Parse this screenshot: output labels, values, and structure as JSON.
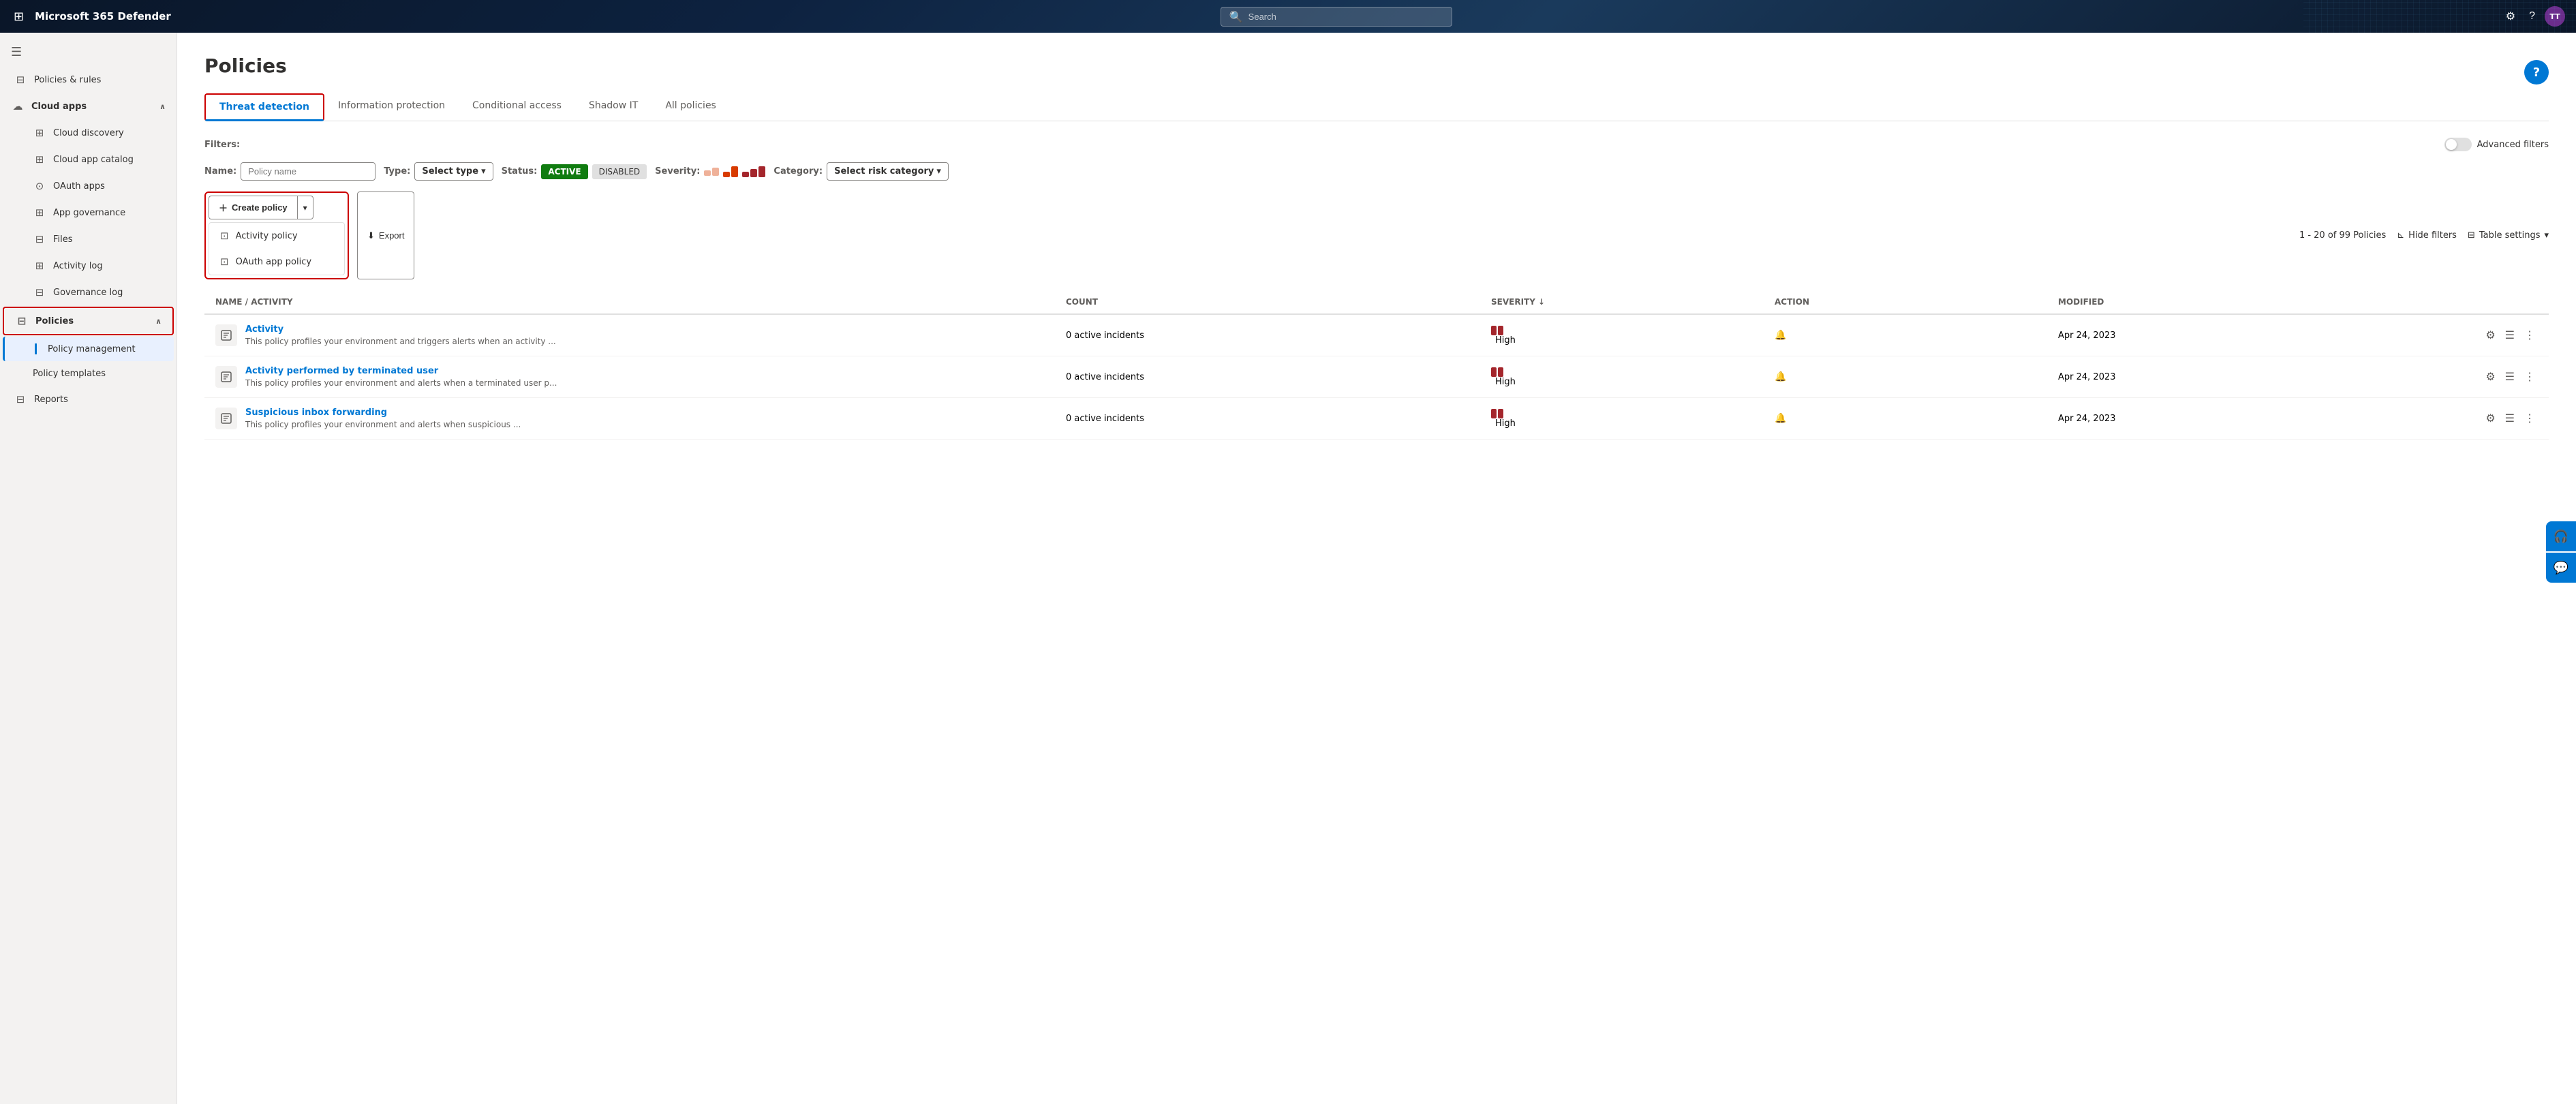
{
  "app": {
    "title": "Microsoft 365 Defender",
    "search_placeholder": "Search"
  },
  "nav_icons": {
    "settings": "⚙",
    "help": "?",
    "avatar": "TT"
  },
  "sidebar": {
    "hamburger": "☰",
    "items": [
      {
        "id": "policies-rules",
        "label": "Policies & rules",
        "icon": "⊟"
      },
      {
        "id": "cloud-apps",
        "label": "Cloud apps",
        "icon": "☁",
        "expanded": true
      },
      {
        "id": "cloud-discovery",
        "label": "Cloud discovery",
        "icon": "⊞",
        "indent": true
      },
      {
        "id": "cloud-app-catalog",
        "label": "Cloud app catalog",
        "icon": "⊞",
        "indent": true
      },
      {
        "id": "oauth-apps",
        "label": "OAuth apps",
        "icon": "⊙",
        "indent": true
      },
      {
        "id": "app-governance",
        "label": "App governance",
        "icon": "⊞",
        "indent": true
      },
      {
        "id": "files",
        "label": "Files",
        "icon": "⊟",
        "indent": true
      },
      {
        "id": "activity-log",
        "label": "Activity log",
        "icon": "⊞",
        "indent": true
      },
      {
        "id": "governance-log",
        "label": "Governance log",
        "icon": "⊟",
        "indent": true
      },
      {
        "id": "policies",
        "label": "Policies",
        "icon": "⊟",
        "expanded": true
      },
      {
        "id": "policy-management",
        "label": "Policy management",
        "icon": "",
        "indent": true,
        "active": true
      },
      {
        "id": "policy-templates",
        "label": "Policy templates",
        "icon": "",
        "indent": true
      },
      {
        "id": "reports",
        "label": "Reports",
        "icon": "⊟"
      }
    ]
  },
  "page": {
    "title": "Policies",
    "help_btn": "?"
  },
  "tabs": [
    {
      "id": "threat-detection",
      "label": "Threat detection",
      "active": true
    },
    {
      "id": "information-protection",
      "label": "Information protection",
      "active": false
    },
    {
      "id": "conditional-access",
      "label": "Conditional access",
      "active": false
    },
    {
      "id": "shadow-it",
      "label": "Shadow IT",
      "active": false
    },
    {
      "id": "all-policies",
      "label": "All policies",
      "active": false
    }
  ],
  "filters": {
    "label": "Filters:",
    "name_label": "Name:",
    "name_placeholder": "Policy name",
    "type_label": "Type:",
    "type_value": "Select type",
    "status_label": "Status:",
    "status_active": "ACTIVE",
    "status_disabled": "DISABLED",
    "severity_label": "Severity:",
    "category_label": "Category:",
    "category_value": "Select risk category",
    "advanced_filters": "Advanced filters"
  },
  "toolbar": {
    "create_policy": "Create policy",
    "export": "Export",
    "count_text": "1 - 20 of 99 Policies",
    "hide_filters": "Hide filters",
    "table_settings": "Table settings"
  },
  "dropdown": {
    "items": [
      {
        "id": "activity-policy",
        "label": "Activity policy",
        "icon": "⊡"
      },
      {
        "id": "oauth-app-policy",
        "label": "OAuth app policy",
        "icon": "⊡"
      }
    ]
  },
  "table": {
    "headers": {
      "name": "Name / Activity",
      "count": "Count",
      "severity": "Severity",
      "action": "Action",
      "modified": "Modified"
    },
    "rows": [
      {
        "id": "row-1",
        "name": "Activity",
        "desc": "This policy profiles your environment and triggers alerts when an activity ...",
        "count": "0 active incidents",
        "severity": "High",
        "modified": "Apr 24, 2023"
      },
      {
        "id": "row-2",
        "name": "Activity performed by terminated user",
        "desc": "This policy profiles your environment and alerts when a terminated user p...",
        "count": "0 active incidents",
        "severity": "High",
        "modified": "Apr 24, 2023"
      },
      {
        "id": "row-3",
        "name": "Suspicious inbox forwarding",
        "desc": "This policy profiles your environment and alerts when suspicious ...",
        "count": "0 active incidents",
        "severity": "High",
        "modified": "Apr 24, 2023"
      }
    ]
  }
}
